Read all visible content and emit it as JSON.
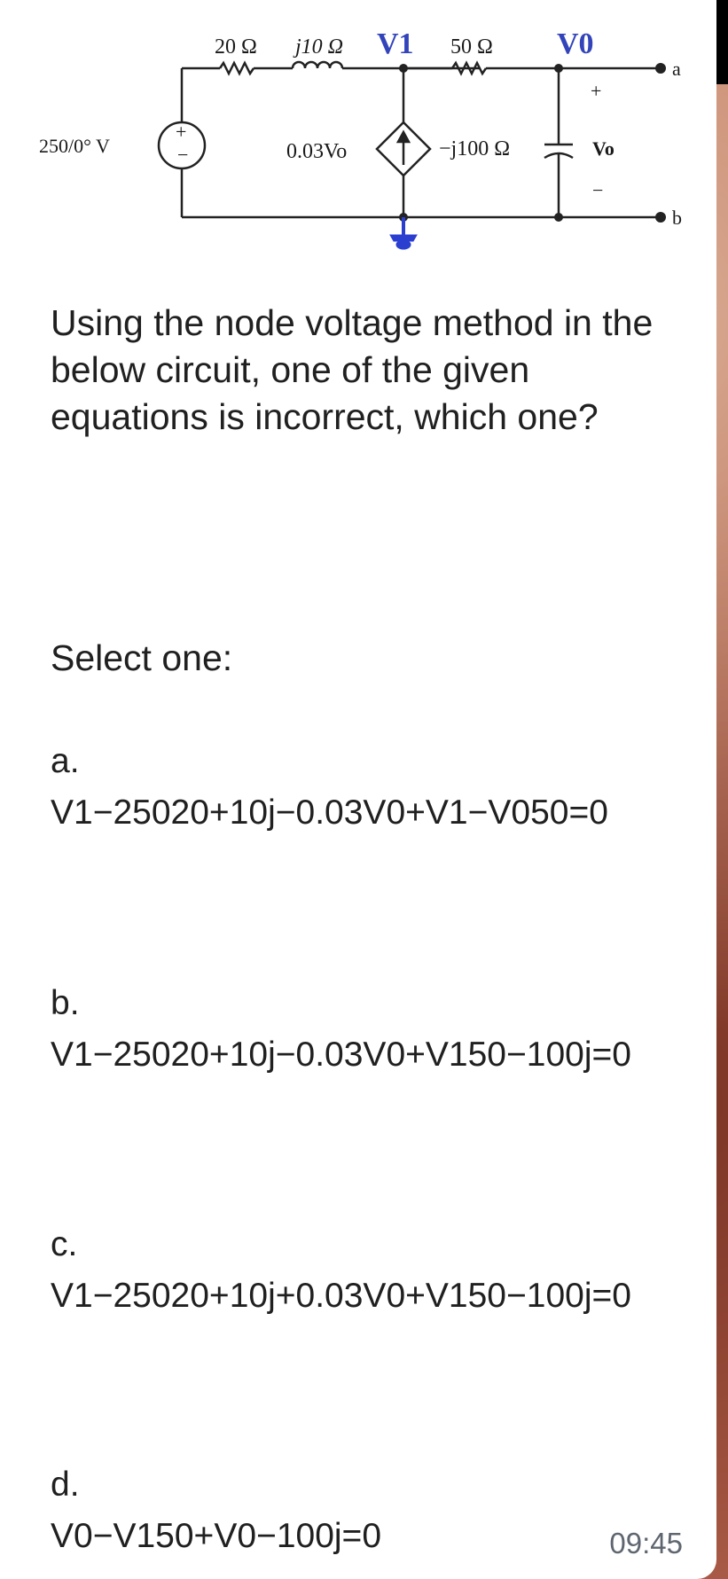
{
  "circuit": {
    "source_label": "250/0° V",
    "r1_label": "20 Ω",
    "l_label": "j10 Ω",
    "node1_label": "V1",
    "r2_label": "50 Ω",
    "node0_label": "V0",
    "dep_source_label": "0.03Vo",
    "cap_label": "−j100 Ω",
    "terminal_a": "a",
    "terminal_b": "b",
    "vo_label": "Vo",
    "plus_sign": "+",
    "minus_sign": "−"
  },
  "question": {
    "text": "Using the node voltage method in the below circuit, one of the given equations is incorrect, which one?"
  },
  "select_one": "Select one:",
  "options": [
    {
      "letter": "a.",
      "equation": "V1−25020+10j−0.03V0+V1−V050=0"
    },
    {
      "letter": "b.",
      "equation": "V1−25020+10j−0.03V0+V150−100j=0"
    },
    {
      "letter": "c.",
      "equation": "V1−25020+10j+0.03V0+V150−100j=0"
    },
    {
      "letter": "d.",
      "equation": "V0−V150+V0−100j=0"
    }
  ],
  "timestamp": "09:45",
  "colors": {
    "node_label": "#3344bb",
    "ground": "#2a3fd0",
    "text": "#202020"
  }
}
